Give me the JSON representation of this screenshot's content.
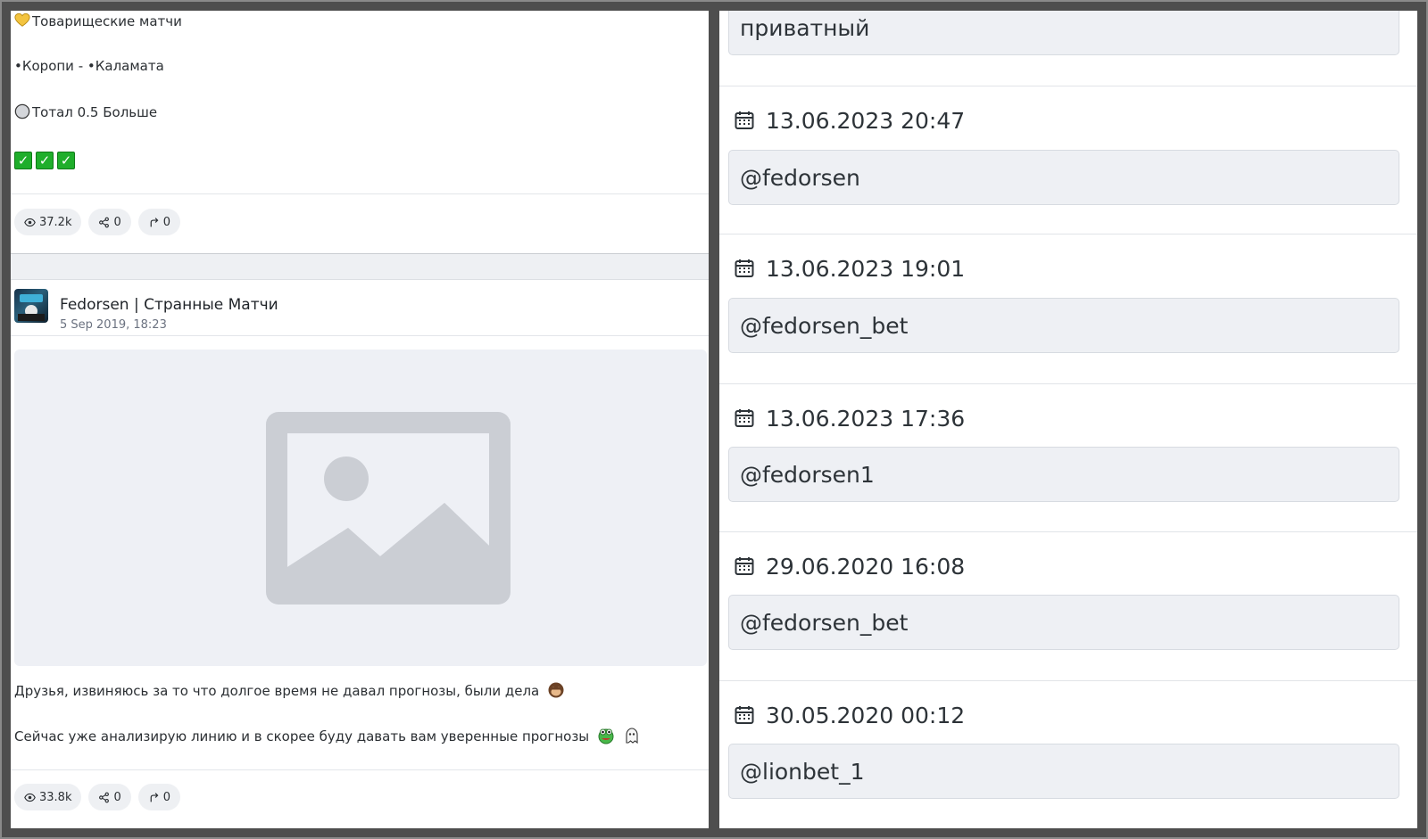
{
  "post1": {
    "lines": [
      "Товарищеские матчи",
      "•Коропи - •Каламата",
      "Тотал 0.5 Больше"
    ],
    "check_count": 3,
    "views": "37.2k",
    "shares": "0",
    "forwards": "0"
  },
  "post2": {
    "channel": "Fedorsen | Странные Матчи",
    "date": "5 Sep 2019, 18:23",
    "text1": "Друзья, извиняюсь за то что долгое время не давал прогнозы, были дела",
    "text2": "Сейчас уже анализирую линию и в скорее буду давать вам уверенные прогнозы",
    "views": "33.8k",
    "shares": "0",
    "forwards": "0"
  },
  "history": [
    {
      "date": "",
      "username": "приватный"
    },
    {
      "date": "13.06.2023 20:47",
      "username": "@fedorsen"
    },
    {
      "date": "13.06.2023 19:01",
      "username": "@fedorsen_bet"
    },
    {
      "date": "13.06.2023 17:36",
      "username": "@fedorsen1"
    },
    {
      "date": "29.06.2020 16:08",
      "username": "@fedorsen_bet"
    },
    {
      "date": "30.05.2020 00:12",
      "username": "@lionbet_1"
    }
  ],
  "colors": {
    "check_green": "#1fae2b",
    "pill_bg": "#eef0f3",
    "box_bg": "#eef0f4",
    "placeholder_gray": "#cbced4"
  },
  "icons": [
    "heart-icon",
    "circle-icon",
    "check-icon",
    "eye-icon",
    "share-icon",
    "forward-icon",
    "calendar-icon",
    "image-placeholder-icon",
    "monkey-icon",
    "frog-icon",
    "ghost-icon"
  ]
}
